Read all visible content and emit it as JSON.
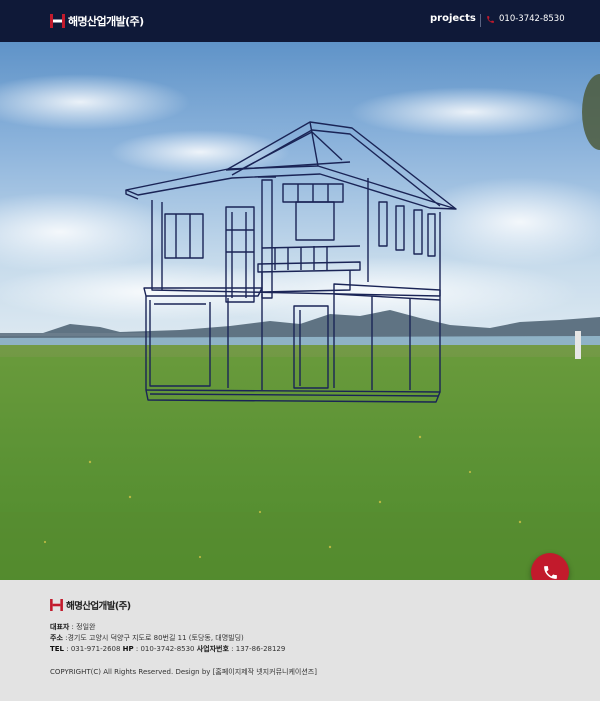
{
  "header": {
    "logo_text": "해명산업개발(주)",
    "nav_projects": "projects",
    "phone": "010-3742-8530"
  },
  "hero": {
    "call_button_icon": "phone-icon"
  },
  "footer": {
    "logo_text": "해명산업개발(주)",
    "ceo_label": "대표자",
    "ceo_value": " : 정일완",
    "address_label": "주소",
    "address_value": " :경기도 고양시 덕양구 지도로 80번길 11 (토당동, 대명빌딩)",
    "tel_label": "TEL",
    "tel_value": " : 031-971-2608 ",
    "hp_label": "HP",
    "hp_value": " : 010-3742-8530 ",
    "bizno_label": "사업자번호",
    "bizno_value": " : 137-86-28129",
    "copyright": "COPYRIGHT(C) All Rights Reserved. Design by [홈페이지제작 넷지커뮤니케이션즈]"
  },
  "colors": {
    "header_bg": "#0f1938",
    "brand_red": "#c21a2c",
    "footer_bg": "#e3e3e3"
  }
}
